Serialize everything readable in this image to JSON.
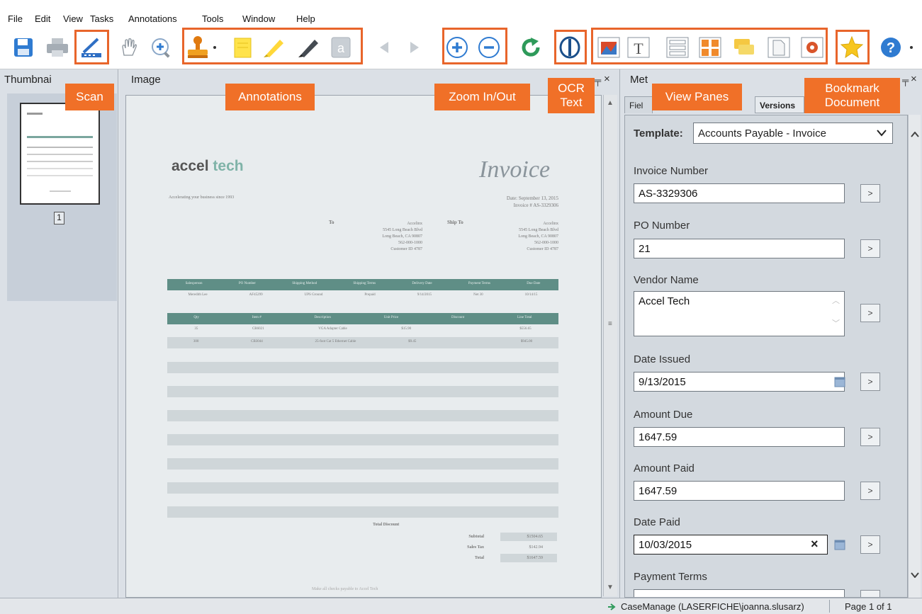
{
  "menu": [
    "File",
    "Edit",
    "View",
    "Tasks",
    "Annotations",
    "Tools",
    "Window",
    "Help"
  ],
  "callouts": {
    "scan": "Scan",
    "annotations": "Annotations",
    "zoom": "Zoom In/Out",
    "ocr_line1": "OCR",
    "ocr_line2": "Text",
    "view_panes": "View Panes",
    "bookmark_line1": "Bookmark",
    "bookmark_line2": "Document"
  },
  "colors": {
    "accent": "#e8652b",
    "callout_bg": "#f07028",
    "logo_teal": "#3f9a8a"
  },
  "panes": {
    "thumbnails": "Thumbnai",
    "image": "Image",
    "metadata": "Met"
  },
  "thumbnail": {
    "page_number": "1"
  },
  "meta_tabs": [
    "Fiel",
    "Versions"
  ],
  "template": {
    "label": "Template:",
    "value": "Accounts Payable - Invoice"
  },
  "fields": [
    {
      "label": "Invoice Number",
      "value": "AS-3329306"
    },
    {
      "label": "PO Number",
      "value": "21"
    },
    {
      "label": "Vendor Name",
      "value": "Accel Tech"
    },
    {
      "label": "Date Issued",
      "value": "9/13/2015"
    },
    {
      "label": "Amount Due",
      "value": "1647.59"
    },
    {
      "label": "Amount Paid",
      "value": "1647.59"
    },
    {
      "label": "Date Paid",
      "value": "10/03/2015"
    },
    {
      "label": "Payment Terms",
      "value": ""
    }
  ],
  "field_button": ">",
  "clear_symbol": "×",
  "invoice": {
    "logo_a": "accel",
    "logo_b": "tech",
    "title": "Invoice",
    "tagline": "Accelerating your business since 1993",
    "date": "Date: September 13, 2015",
    "number": "Invoice # AS-3329306",
    "to_label": "To",
    "ship_label": "Ship To",
    "to": [
      "Accelinx",
      "5545 Long Beach Blvd",
      "Long Beach, CA 90807",
      "562-000-1000",
      "Customer ID 4787"
    ],
    "ship": [
      "Accelinx",
      "5545 Long Beach Blvd",
      "Long Beach, CA 90807",
      "562-000-1000",
      "Customer ID 4787"
    ],
    "table1_header": [
      "Salesperson",
      "PO Number",
      "Shipping Method",
      "Shipping Terms",
      "Delivery Date",
      "Payment Terms",
      "Due Date"
    ],
    "table1_row": [
      "Meredith Lee",
      "AF45299",
      "UPS Ground",
      "Prepaid",
      "9/14/2015",
      "Net 30",
      "10/14/15"
    ],
    "table2_header": [
      "Qty",
      "Item #",
      "Description",
      "Unit Price",
      "Discount",
      "Line Total"
    ],
    "table2_rows": [
      [
        "35",
        "CB6021",
        "VGA Adapter Cable",
        "$15.90",
        "",
        "$556.65"
      ],
      [
        "300",
        "CB3044",
        "25-foot Cat 5 Ethernet Cable",
        "$9.45",
        "",
        "$945.00"
      ]
    ],
    "total_discount": "Total Discount",
    "subtotal_label": "Subtotal",
    "subtotal": "$1504.65",
    "tax_label": "Sales Tax",
    "tax": "$142.94",
    "total_label": "Total",
    "total": "$1647.59",
    "footer": "Make all checks payable to Accel Tech"
  },
  "status": {
    "repository": "CaseManage (LASERFICHE\\joanna.slusarz)",
    "page": "Page 1 of 1"
  }
}
